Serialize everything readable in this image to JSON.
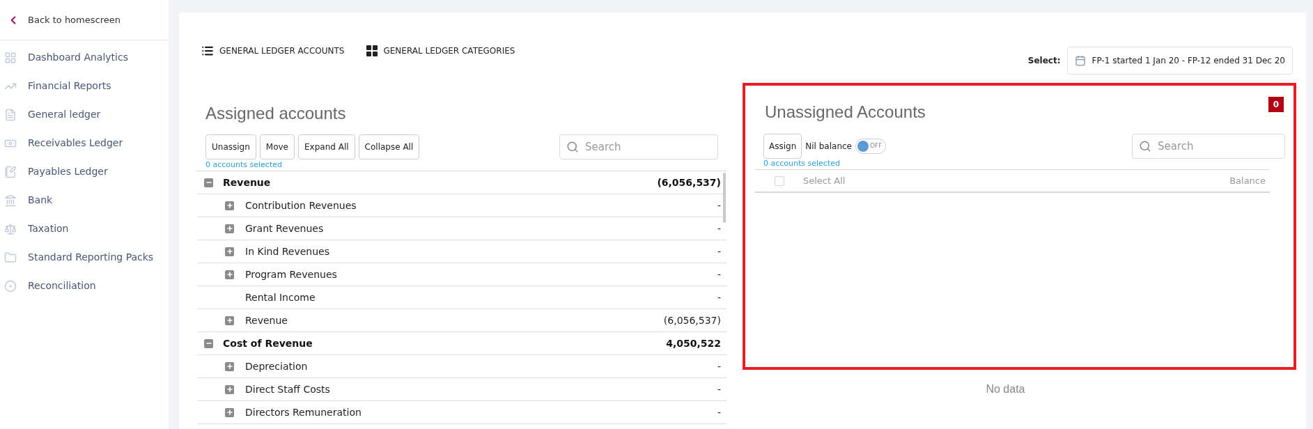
{
  "sidebar": {
    "back": "Back to homescreen",
    "items": [
      {
        "label": "Dashboard Analytics",
        "kind": "grid"
      },
      {
        "label": "Financial Reports",
        "kind": "trend"
      },
      {
        "label": "General ledger",
        "kind": "document"
      },
      {
        "label": "Receivables Ledger",
        "kind": "banknote"
      },
      {
        "label": "Payables Ledger",
        "kind": "notepad"
      },
      {
        "label": "Bank",
        "kind": "bank"
      },
      {
        "label": "Taxation",
        "kind": "scale"
      },
      {
        "label": "Standard Reporting Packs",
        "kind": "folder"
      },
      {
        "label": "Reconciliation",
        "kind": "target"
      }
    ]
  },
  "view_tabs": [
    {
      "label": "GENERAL LEDGER ACCOUNTS",
      "kind": "list"
    },
    {
      "label": "GENERAL LEDGER CATEGORIES",
      "kind": "tiles"
    }
  ],
  "period": {
    "label": "Select:",
    "value": "FP-1 started 1 Jan 20 - FP-12 ended 31 Dec 20"
  },
  "assigned": {
    "title": "Assigned accounts",
    "buttons": [
      "Unassign",
      "Move",
      "Expand All",
      "Collapse All"
    ],
    "search": {
      "placeholder": "Search"
    },
    "selection_note": "0 accounts selected",
    "tree": [
      {
        "name": "Revenue",
        "amount": "(6,056,537)",
        "expanded": true,
        "children": [
          {
            "name": "Contribution Revenues",
            "amount": "-",
            "kind": "expandable"
          },
          {
            "name": "Grant Revenues",
            "amount": "-",
            "kind": "expandable"
          },
          {
            "name": "In Kind Revenues",
            "amount": "-",
            "kind": "expandable"
          },
          {
            "name": "Program Revenues",
            "amount": "-",
            "kind": "expandable"
          },
          {
            "name": "Rental Income",
            "amount": "-",
            "kind": "leaf"
          },
          {
            "name": "Revenue",
            "amount": "(6,056,537)",
            "kind": "expandable"
          }
        ]
      },
      {
        "name": "Cost of Revenue",
        "amount": "4,050,522",
        "expanded": true,
        "children": [
          {
            "name": "Depreciation",
            "amount": "-",
            "kind": "expandable"
          },
          {
            "name": "Direct Staff Costs",
            "amount": "-",
            "kind": "expandable"
          },
          {
            "name": "Directors Remuneration",
            "amount": "-",
            "kind": "expandable"
          }
        ]
      }
    ]
  },
  "unassigned": {
    "title": "Unassigned Accounts",
    "count": "0",
    "button": "Assign",
    "nil_balance": {
      "label": "Nil balance",
      "on": false,
      "state_text": "OFF"
    },
    "search": {
      "placeholder": "Search"
    },
    "selection_note": "0 accounts selected",
    "columns": [
      {
        "label": "Select All",
        "checked": false
      },
      {
        "label": "Balance"
      }
    ],
    "empty_text": "No data"
  }
}
